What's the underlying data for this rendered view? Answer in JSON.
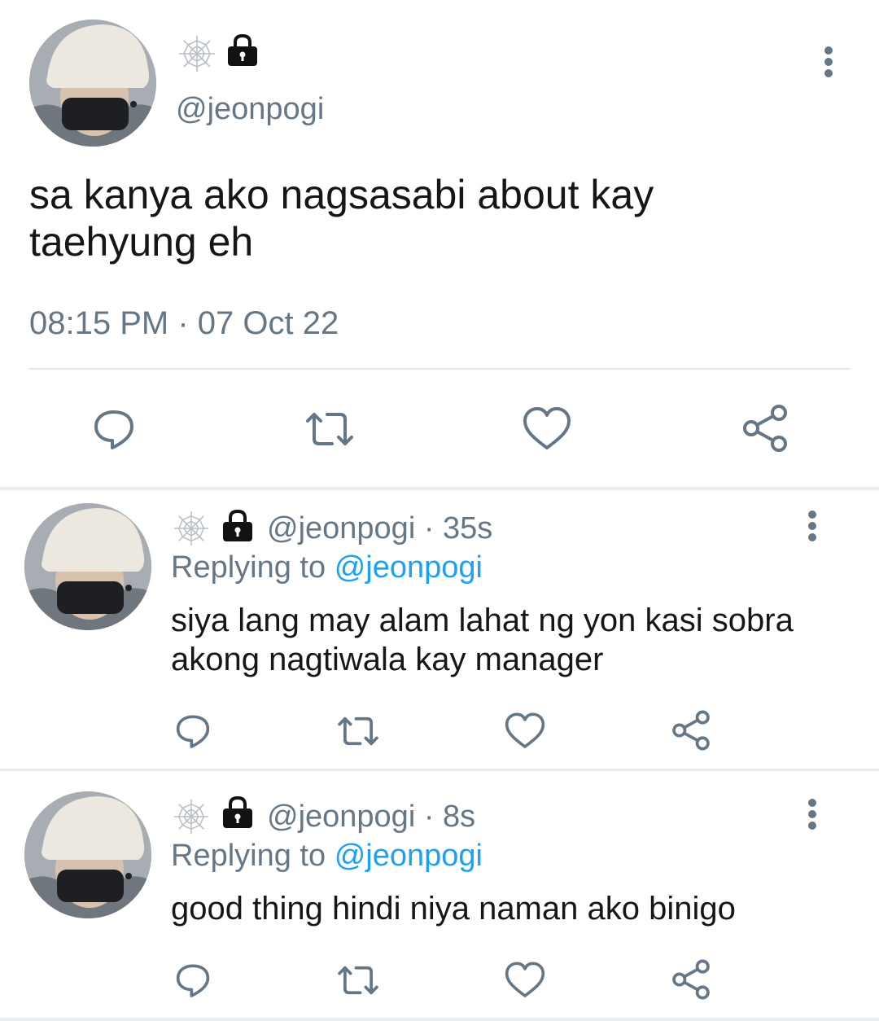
{
  "main_tweet": {
    "name_icons": [
      "spider-web-icon",
      "lock-icon"
    ],
    "handle": "@jeonpogi",
    "text_line1": "sa kanya ako nagsasabi about kay",
    "text_line2": "taehyung eh",
    "timestamp": "08:15 PM · 07 Oct 22",
    "actions": [
      "reply-icon",
      "retweet-icon",
      "like-icon",
      "share-icon"
    ]
  },
  "replies": [
    {
      "handle": "@jeonpogi",
      "time": "· 35s",
      "replying_prefix": "Replying to",
      "replying_handle": "@jeonpogi",
      "text_line1": "siya lang may alam lahat ng yon kasi sobra",
      "text_line2": "akong nagtiwala kay manager"
    },
    {
      "handle": "@jeonpogi",
      "time": "· 8s",
      "replying_prefix": "Replying to",
      "replying_handle": "@jeonpogi",
      "text_line1": "good thing hindi niya naman ako binigo",
      "text_line2": ""
    }
  ],
  "colors": {
    "text": "#14171a",
    "muted": "#657786",
    "link": "#1da1f2",
    "divider": "#e6ecf0"
  }
}
